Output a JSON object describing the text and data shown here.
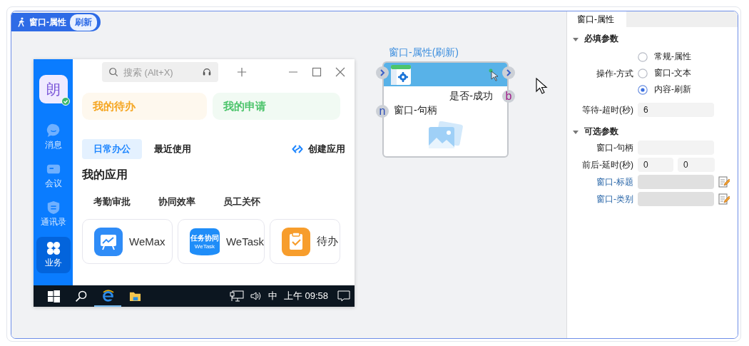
{
  "badge": {
    "title": "窗口-属性",
    "tag": "刷新"
  },
  "screenshot": {
    "sidebar": {
      "avatar": "朗",
      "items": [
        {
          "kind": "chat",
          "label": "消息",
          "selected": false
        },
        {
          "kind": "camera",
          "label": "会议",
          "selected": false
        },
        {
          "kind": "contacts",
          "label": "通讯录",
          "selected": false
        },
        {
          "kind": "apps",
          "label": "业务",
          "selected": true
        }
      ]
    },
    "search": {
      "placeholder": "搜索 (Alt+X)"
    },
    "cards": [
      {
        "label": "我的待办",
        "color": "#f5a623"
      },
      {
        "label": "我的申请",
        "color": "#4cc46b"
      }
    ],
    "tabs": [
      {
        "label": "日常办公",
        "selected": true
      },
      {
        "label": "最近使用",
        "selected": false
      }
    ],
    "create": "创建应用",
    "heading": "我的应用",
    "categories": [
      "考勤审批",
      "协同效率",
      "员工关怀"
    ],
    "apps": [
      {
        "kind": "chart",
        "name": "WeMax"
      },
      {
        "kind": "banner",
        "name": "WeTask",
        "icon_text": "任务协同",
        "icon_subtext": "WeTask"
      },
      {
        "kind": "clipboard",
        "name": "待办"
      }
    ],
    "taskbar": {
      "apps": [
        {
          "kind": "start",
          "selected": false
        },
        {
          "kind": "search",
          "selected": false
        },
        {
          "kind": "browser",
          "selected": true
        },
        {
          "kind": "folder",
          "selected": false
        }
      ],
      "ime": "中",
      "clock": "上午 09:58"
    }
  },
  "node": {
    "title": "窗口-属性(刷新)",
    "outputs": [
      {
        "port": "b",
        "label": "是否-成功"
      }
    ],
    "inputs": [
      {
        "port": "n",
        "label": "窗口-句柄"
      }
    ]
  },
  "panel": {
    "tab": "窗口-属性",
    "sections": [
      {
        "title": "必填参数",
        "expanded": true,
        "rows": [
          {
            "kind": "radio",
            "label": "操作-方式",
            "options": [
              {
                "label": "常规-属性",
                "selected": false
              },
              {
                "label": "窗口-文本",
                "selected": false
              },
              {
                "label": "内容-刷新",
                "selected": true
              }
            ]
          },
          {
            "kind": "field",
            "label": "等待-超时(秒)",
            "value": "6"
          }
        ]
      },
      {
        "title": "可选参数",
        "expanded": true,
        "rows": [
          {
            "kind": "field",
            "label": "窗口-句柄"
          },
          {
            "kind": "pair",
            "label": "前后-延时(秒)",
            "values": [
              "0",
              "0"
            ]
          },
          {
            "kind": "picker",
            "label": "窗口-标题"
          },
          {
            "kind": "picker",
            "label": "窗口-类别"
          }
        ]
      }
    ]
  }
}
